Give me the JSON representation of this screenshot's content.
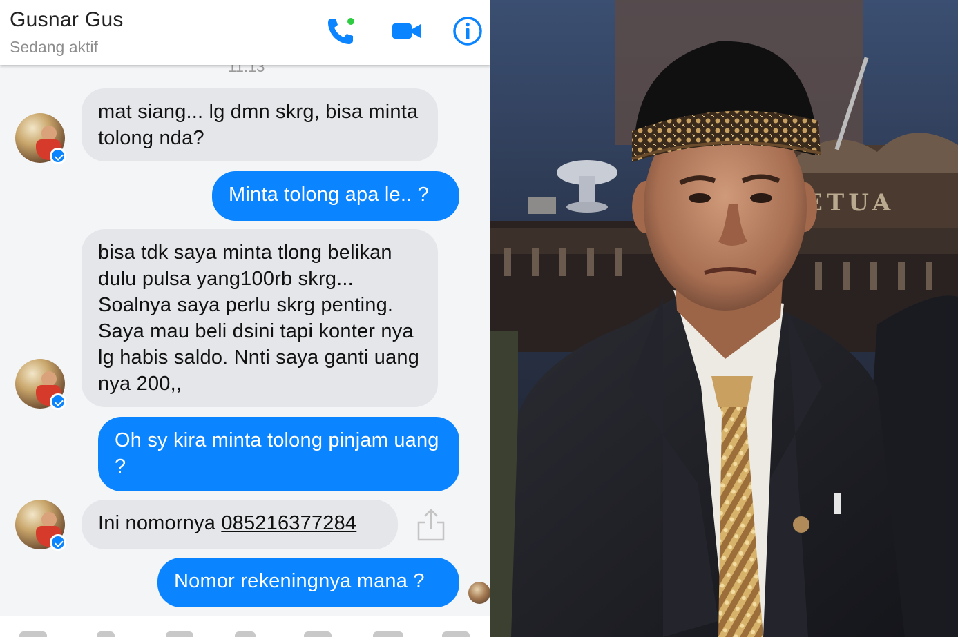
{
  "header": {
    "contact_name": "Gusnar Gus",
    "status": "Sedang aktif",
    "icons": [
      "phone-call-icon",
      "video-call-icon",
      "info-icon"
    ]
  },
  "conversation": {
    "timestamp": "11.13",
    "messages": [
      {
        "sender": "contact",
        "text": "mat siang... lg dmn skrg, bisa minta tolong nda?"
      },
      {
        "sender": "self",
        "text": "Minta tolong apa le.. ?"
      },
      {
        "sender": "contact",
        "text": "bisa tdk saya minta tlong belikan dulu pulsa yang100rb skrg... Soalnya saya perlu skrg penting. Saya mau beli dsini tapi konter nya lg habis saldo. Nnti saya ganti uang nya 200,,"
      },
      {
        "sender": "self",
        "text": "Oh sy kira minta tolong pinjam uang ?"
      },
      {
        "sender": "contact",
        "text_prefix": "Ini nomornya ",
        "phone_number": "085216377284"
      },
      {
        "sender": "self",
        "text": "Nomor rekeningnya mana ?"
      }
    ]
  },
  "photo": {
    "sign_text": "ETUA"
  },
  "colors": {
    "accent": "#0a84ff",
    "incoming_bubble": "#e5e6ea",
    "status_dot": "#2ecc40"
  }
}
